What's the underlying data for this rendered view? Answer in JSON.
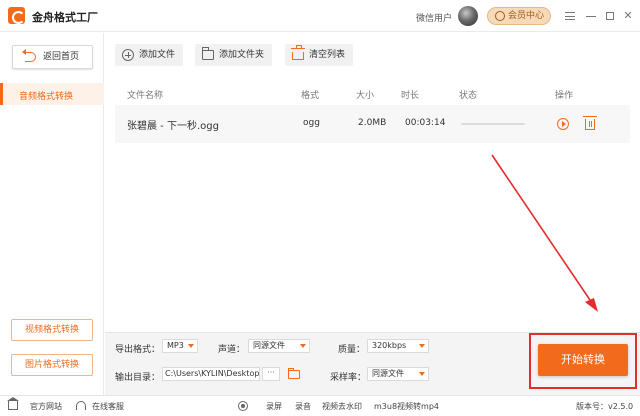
{
  "app": {
    "title": "金舟格式工厂",
    "user_label": "微信用户",
    "vip_label": "会员中心",
    "accent_color": "#f26b1d"
  },
  "sidebar": {
    "back_label": "返回首页",
    "active_item": "音频格式转换",
    "video_btn": "视频格式转换",
    "image_btn": "图片格式转换"
  },
  "toolbar": {
    "add_file": "添加文件",
    "add_folder": "添加文件夹",
    "clear_list": "清空列表"
  },
  "file_table": {
    "columns": [
      "文件名称",
      "格式",
      "大小",
      "时长",
      "状态",
      "操作"
    ],
    "rows": [
      {
        "name": "张碧晨 - 下一秒.ogg",
        "format": "ogg",
        "size": "2.0MB",
        "duration": "00:03:14",
        "progress": 0
      }
    ]
  },
  "settings": {
    "format_label": "导出格式：",
    "format_value": "MP3",
    "channel_label": "声道：",
    "channel_value": "同源文件",
    "quality_label": "质量：",
    "quality_value": "320kbps",
    "output_label": "输出目录：",
    "output_path": "C:\\Users\\KYLIN\\Desktop\\",
    "more_label": "···",
    "samplerate_label": "采样率：",
    "samplerate_value": "同源文件",
    "start_label": "开始转换"
  },
  "statusbar": {
    "site": "官方网站",
    "support": "在线客服",
    "record": "录屏",
    "audio_record": "录音",
    "watermark": "视频去水印",
    "m3u8": "m3u8视频转mp4",
    "version": "版本号：v2.5.0"
  }
}
